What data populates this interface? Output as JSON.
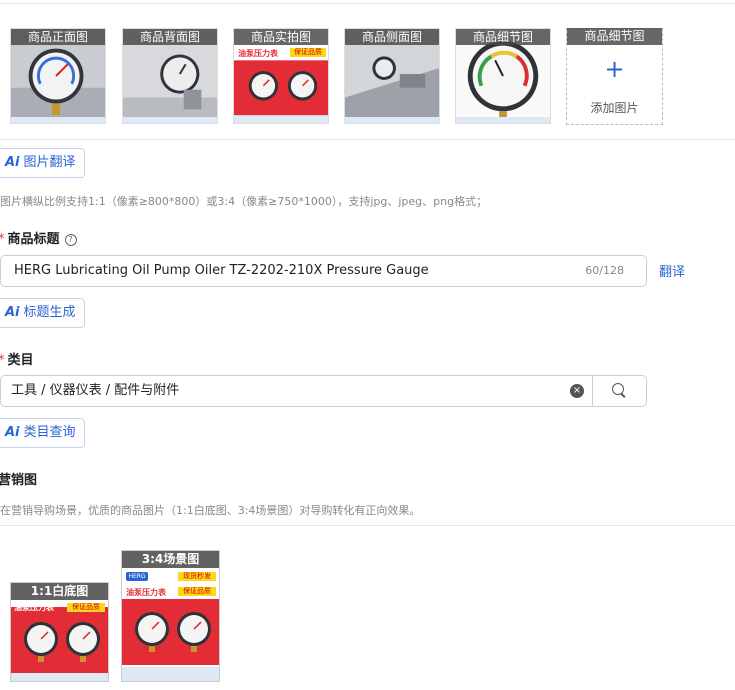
{
  "gallery": {
    "thumbs": [
      {
        "label": "商品正面图"
      },
      {
        "label": "商品背面图"
      },
      {
        "label": "商品实拍图",
        "banner": "油泵压力表",
        "tag": "保证品质"
      },
      {
        "label": "商品侧面图"
      },
      {
        "label": "商品细节图"
      }
    ],
    "add": {
      "label": "商品细节图",
      "plus": "+",
      "text": "添加图片"
    }
  },
  "image_translate_button": {
    "ai": "Ai",
    "label": "图片翻译"
  },
  "image_hint": "图片横纵比例支持1:1（像素≥800*800）或3:4（像素≥750*1000），支持jpg、jpeg、png格式；",
  "title_section": {
    "required_mark": "*",
    "label": "商品标题",
    "help_icon": "?",
    "value": "HERG Lubricating Oil Pump Oiler TZ-2202-210X Pressure Gauge",
    "count": "60/128",
    "translate_link": "翻译",
    "generate_button": {
      "ai": "Ai",
      "label": "标题生成"
    }
  },
  "category_section": {
    "required_mark": "*",
    "label": "类目",
    "value": "工具 / 仪器仪表 / 配件与附件",
    "clear_icon": "×",
    "query_button": {
      "ai": "Ai",
      "label": "类目查询"
    }
  },
  "marketing_section": {
    "label": "营销图",
    "hint": "在营销导购场景，优质的商品图片（1:1白底图、3:4场景图）对导购转化有正向效果。",
    "images": [
      {
        "label": "1:1白底图",
        "banner": "油泵压力表",
        "tag": "保证品质"
      },
      {
        "label": "3:4场景图",
        "banner": "油泵压力表",
        "logo": "HERG",
        "tag": "保证品质",
        "tag2": "现货秒发"
      }
    ]
  },
  "colors": {
    "accent": "#2a63d6",
    "required": "#e33333",
    "banner_red": "#e32d36"
  },
  "icons": {
    "gauge": "pressure-gauge-icon",
    "search": "search-icon",
    "clear": "clear-icon",
    "help": "help-icon",
    "plus": "plus-icon"
  }
}
